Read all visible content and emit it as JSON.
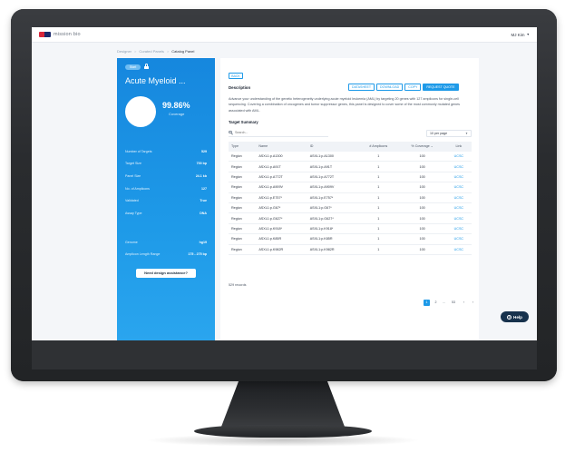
{
  "app": {
    "logo_text": "mission bio",
    "user_name": "MJ Kim"
  },
  "breadcrumb": {
    "items": [
      "Designer",
      "Curated Panels",
      "Catalog Panel"
    ]
  },
  "panel": {
    "badge": "Start",
    "title": "Acute Myeloid ...",
    "coverage_value": "99.86%",
    "coverage_label": "Coverage",
    "stats": [
      {
        "label": "Number of Targets",
        "value": "529"
      },
      {
        "label": "Target Size",
        "value": "700 bp"
      },
      {
        "label": "Panel Size",
        "value": "24.1 kb"
      },
      {
        "label": "No. of Amplicons",
        "value": "127"
      },
      {
        "label": "Validated",
        "value": "True"
      },
      {
        "label": "Assay Type",
        "value": "DNA"
      }
    ],
    "stats2": [
      {
        "label": "Genome",
        "value": "hg19"
      },
      {
        "label": "Amplicon Length Range",
        "value": "175 - 275 bp"
      }
    ],
    "assist_button": "Need design assistance?"
  },
  "card": {
    "back_label": "BACK",
    "description_title": "Description",
    "buttons": [
      "DATASHEET",
      "DOWNLOAD",
      "COPY",
      "REQUEST QUOTE"
    ],
    "description": "Advance your understanding of the genetic heterogeneity underlying acute myeloid leukemia (AML) by targeting 20 genes with 127 amplicons for single-cell sequencing. Covering a combination of oncogenes and tumor suppressor genes, this panel is designed to cover some of the most commonly mutated genes associated with AML.",
    "summary_title": "Target Summary",
    "search_placeholder": "Search...",
    "per_page": "10 per page"
  },
  "table": {
    "columns": [
      "Type",
      "Name",
      "ID",
      "# Amplicons",
      "% Coverage",
      "Link"
    ],
    "rows": [
      [
        "Region",
        "ASXL1:p.A1300",
        "ASXL1:p.A1300",
        "1",
        "100",
        "UCSC"
      ],
      [
        "Region",
        "ASXL1:p.A91T",
        "ASXL1:p.A91T",
        "1",
        "100",
        "UCSC"
      ],
      [
        "Region",
        "ASXL1:p.A772T",
        "ASXL1:p.A772T",
        "1",
        "100",
        "UCSC"
      ],
      [
        "Region",
        "ASXL1:p.A909V",
        "ASXL1:p.A909V",
        "1",
        "100",
        "UCSC"
      ],
      [
        "Region",
        "ASXL1:p.E757*",
        "ASXL1:p.E757*",
        "1",
        "100",
        "UCSC"
      ],
      [
        "Region",
        "ASXL1:p.G67*",
        "ASXL1:p.G67*",
        "1",
        "100",
        "UCSC"
      ],
      [
        "Region",
        "ASXL1:p.G627*",
        "ASXL1:p.G627*",
        "1",
        "100",
        "UCSC"
      ],
      [
        "Region",
        "ASXL1:p.K918*",
        "ASXL1:p.K918*",
        "1",
        "100",
        "UCSC"
      ],
      [
        "Region",
        "ASXL1:p.K85R",
        "ASXL1:p.K85R",
        "1",
        "100",
        "UCSC"
      ],
      [
        "Region",
        "ASXL1:p.K982R",
        "ASXL1:p.K982R",
        "1",
        "100",
        "UCSC"
      ]
    ],
    "records_text": "529 records"
  },
  "pagination": {
    "pages": [
      "1",
      "2",
      "...",
      "53"
    ],
    "prev": "‹",
    "next": "›"
  },
  "help": {
    "label": "Help",
    "icon_glyph": "?"
  },
  "colors": {
    "accent": "#1e9ae8",
    "panel_blue": "#1687de",
    "help_bg": "#17324d",
    "brand_red": "#d8263b"
  }
}
